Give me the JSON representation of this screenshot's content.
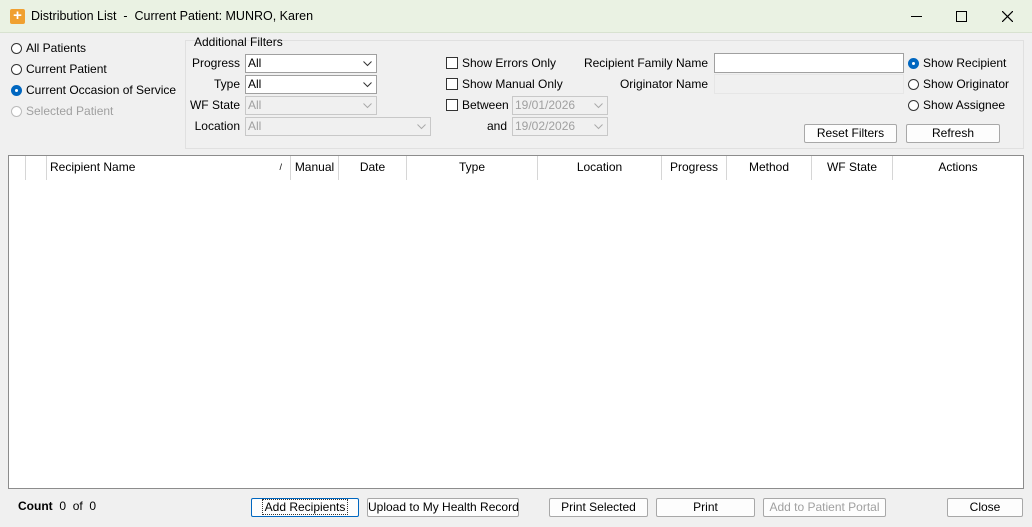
{
  "window": {
    "title": "Distribution List  -  Current Patient: MUNRO, Karen"
  },
  "scope_options": [
    {
      "label": "All Patients",
      "selected": false,
      "enabled": true
    },
    {
      "label": "Current Patient",
      "selected": false,
      "enabled": true
    },
    {
      "label": "Current Occasion of Service",
      "selected": true,
      "enabled": true
    },
    {
      "label": "Selected Patient",
      "selected": false,
      "enabled": false
    }
  ],
  "filters": {
    "group_label": "Additional Filters",
    "progress": {
      "label": "Progress",
      "value": "All"
    },
    "type": {
      "label": "Type",
      "value": "All"
    },
    "wf_state": {
      "label": "WF State",
      "value": "All"
    },
    "location": {
      "label": "Location",
      "value": "All"
    },
    "show_errors_only": "Show Errors Only",
    "show_manual_only": "Show Manual Only",
    "between": {
      "label": "Between",
      "from": "19/01/2026",
      "and_label": "and",
      "to": "19/02/2026"
    },
    "recipient_family_name": {
      "label": "Recipient Family Name",
      "value": ""
    },
    "originator_name": {
      "label": "Originator Name",
      "value": ""
    },
    "show_options": [
      {
        "label": "Show Recipient",
        "selected": true
      },
      {
        "label": "Show Originator",
        "selected": false
      },
      {
        "label": "Show Assignee",
        "selected": false
      }
    ],
    "reset_button": "Reset Filters",
    "refresh_button": "Refresh"
  },
  "grid": {
    "sort_marker": "/",
    "columns": [
      "Recipient Name",
      "Manual",
      "Date",
      "Type",
      "Location",
      "Progress",
      "Method",
      "WF State",
      "Actions"
    ]
  },
  "footer": {
    "count_label": "Count",
    "count_value": "0",
    "of_label": "of",
    "total": "0",
    "buttons": {
      "add_recipients": "Add Recipients",
      "upload": "Upload to My Health Record",
      "print_selected": "Print Selected",
      "print": "Print",
      "add_to_portal": "Add to Patient Portal",
      "close": "Close"
    }
  },
  "icons": {
    "app": "plus-icon",
    "minimize": "minimize-icon",
    "maximize": "maximize-icon",
    "close": "close-icon",
    "dropdown": "chevron-down-icon"
  },
  "colors": {
    "titlebar_bg": "#eaf2e3",
    "accent": "#0067c0",
    "app_icon": "#f0a030"
  }
}
